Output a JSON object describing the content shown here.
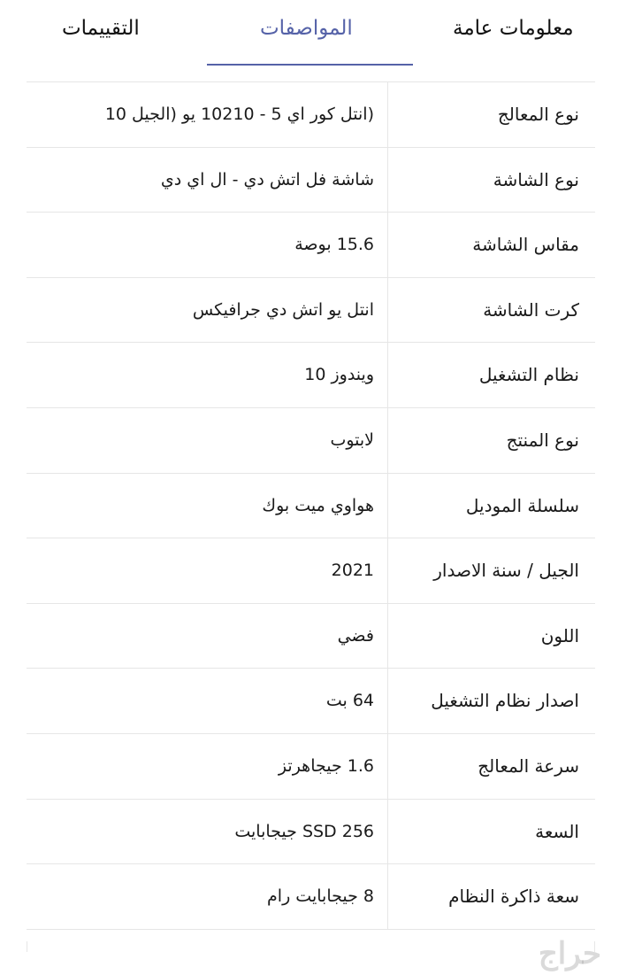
{
  "tabs": {
    "reviews": "التقييمات",
    "specs": "المواصفات",
    "general": "معلومات عامة",
    "active_color": "#5562a8"
  },
  "specs": [
    {
      "label": "نوع المعالج",
      "value": "(انتل كور اي 5 - 10210 يو (الجيل 10"
    },
    {
      "label": "نوع الشاشة",
      "value": "شاشة فل اتش دي - ال اي دي"
    },
    {
      "label": "مقاس الشاشة",
      "value": "15.6 بوصة"
    },
    {
      "label": "كرت الشاشة",
      "value": "انتل يو اتش دي جرافيكس"
    },
    {
      "label": "نظام التشغيل",
      "value": "ويندوز 10"
    },
    {
      "label": "نوع المنتج",
      "value": "لابتوب"
    },
    {
      "label": "سلسلة الموديل",
      "value": "هواوي ميت بوك"
    },
    {
      "label": "الجيل / سنة الاصدار",
      "value": "2021"
    },
    {
      "label": "اللون",
      "value": "فضي"
    },
    {
      "label": "اصدار نظام التشغيل",
      "value": "64 بت"
    },
    {
      "label": "سرعة المعالج",
      "value": "1.6 جيجاهرتز"
    },
    {
      "label": "السعة",
      "value": "SSD  256 جيجابايت"
    },
    {
      "label": "سعة ذاكرة النظام",
      "value": "8 جيجابايت رام"
    }
  ],
  "watermark": "حراج"
}
